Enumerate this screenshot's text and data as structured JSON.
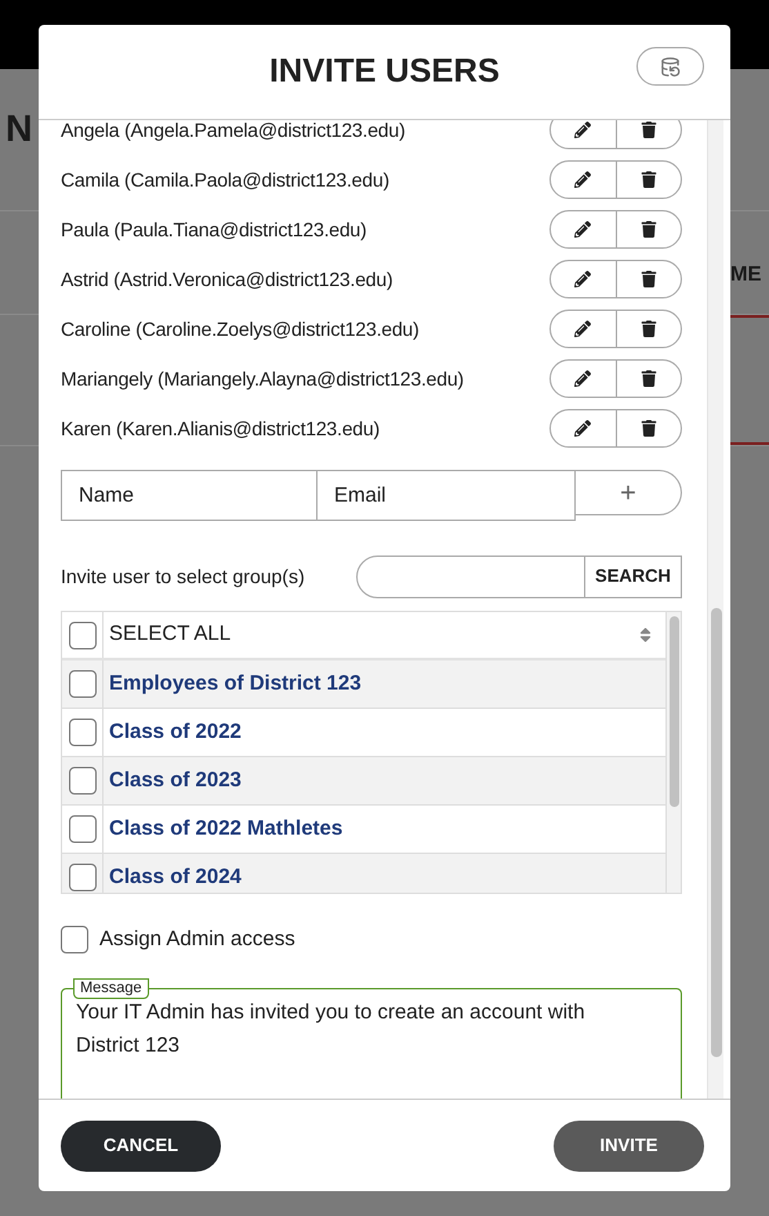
{
  "background": {
    "heading_fragment": "N",
    "column_fragment": "ME"
  },
  "dialog": {
    "title": "INVITE USERS"
  },
  "invitees": [
    {
      "label": "Angela (Angela.Pamela@district123.edu)"
    },
    {
      "label": "Camila (Camila.Paola@district123.edu)"
    },
    {
      "label": "Paula (Paula.Tiana@district123.edu)"
    },
    {
      "label": "Astrid (Astrid.Veronica@district123.edu)"
    },
    {
      "label": "Caroline (Caroline.Zoelys@district123.edu)"
    },
    {
      "label": "Mariangely (Mariangely.Alayna@district123.edu)"
    },
    {
      "label": "Karen (Karen.Alianis@district123.edu)"
    }
  ],
  "new_invitee": {
    "name_field": {
      "placeholder": "Name"
    },
    "email_field": {
      "placeholder": "Email"
    },
    "add_button": "+"
  },
  "groups": {
    "label": "Invite user to select group(s)",
    "search_button": "SEARCH",
    "select_all": {
      "label": "SELECT ALL",
      "checked": false
    },
    "items": [
      {
        "label": "Employees of District 123",
        "checked": false
      },
      {
        "label": "Class of 2022",
        "checked": false
      },
      {
        "label": "Class of 2023",
        "checked": false
      },
      {
        "label": "Class of 2022 Mathletes",
        "checked": false
      },
      {
        "label": "Class of 2024",
        "checked": false
      }
    ]
  },
  "admin_access": {
    "label": "Assign Admin access",
    "checked": false
  },
  "message": {
    "legend": "Message",
    "value": "Your IT Admin has invited you to create an account with District 123"
  },
  "buttons": {
    "cancel": "CANCEL",
    "invite": "INVITE"
  }
}
